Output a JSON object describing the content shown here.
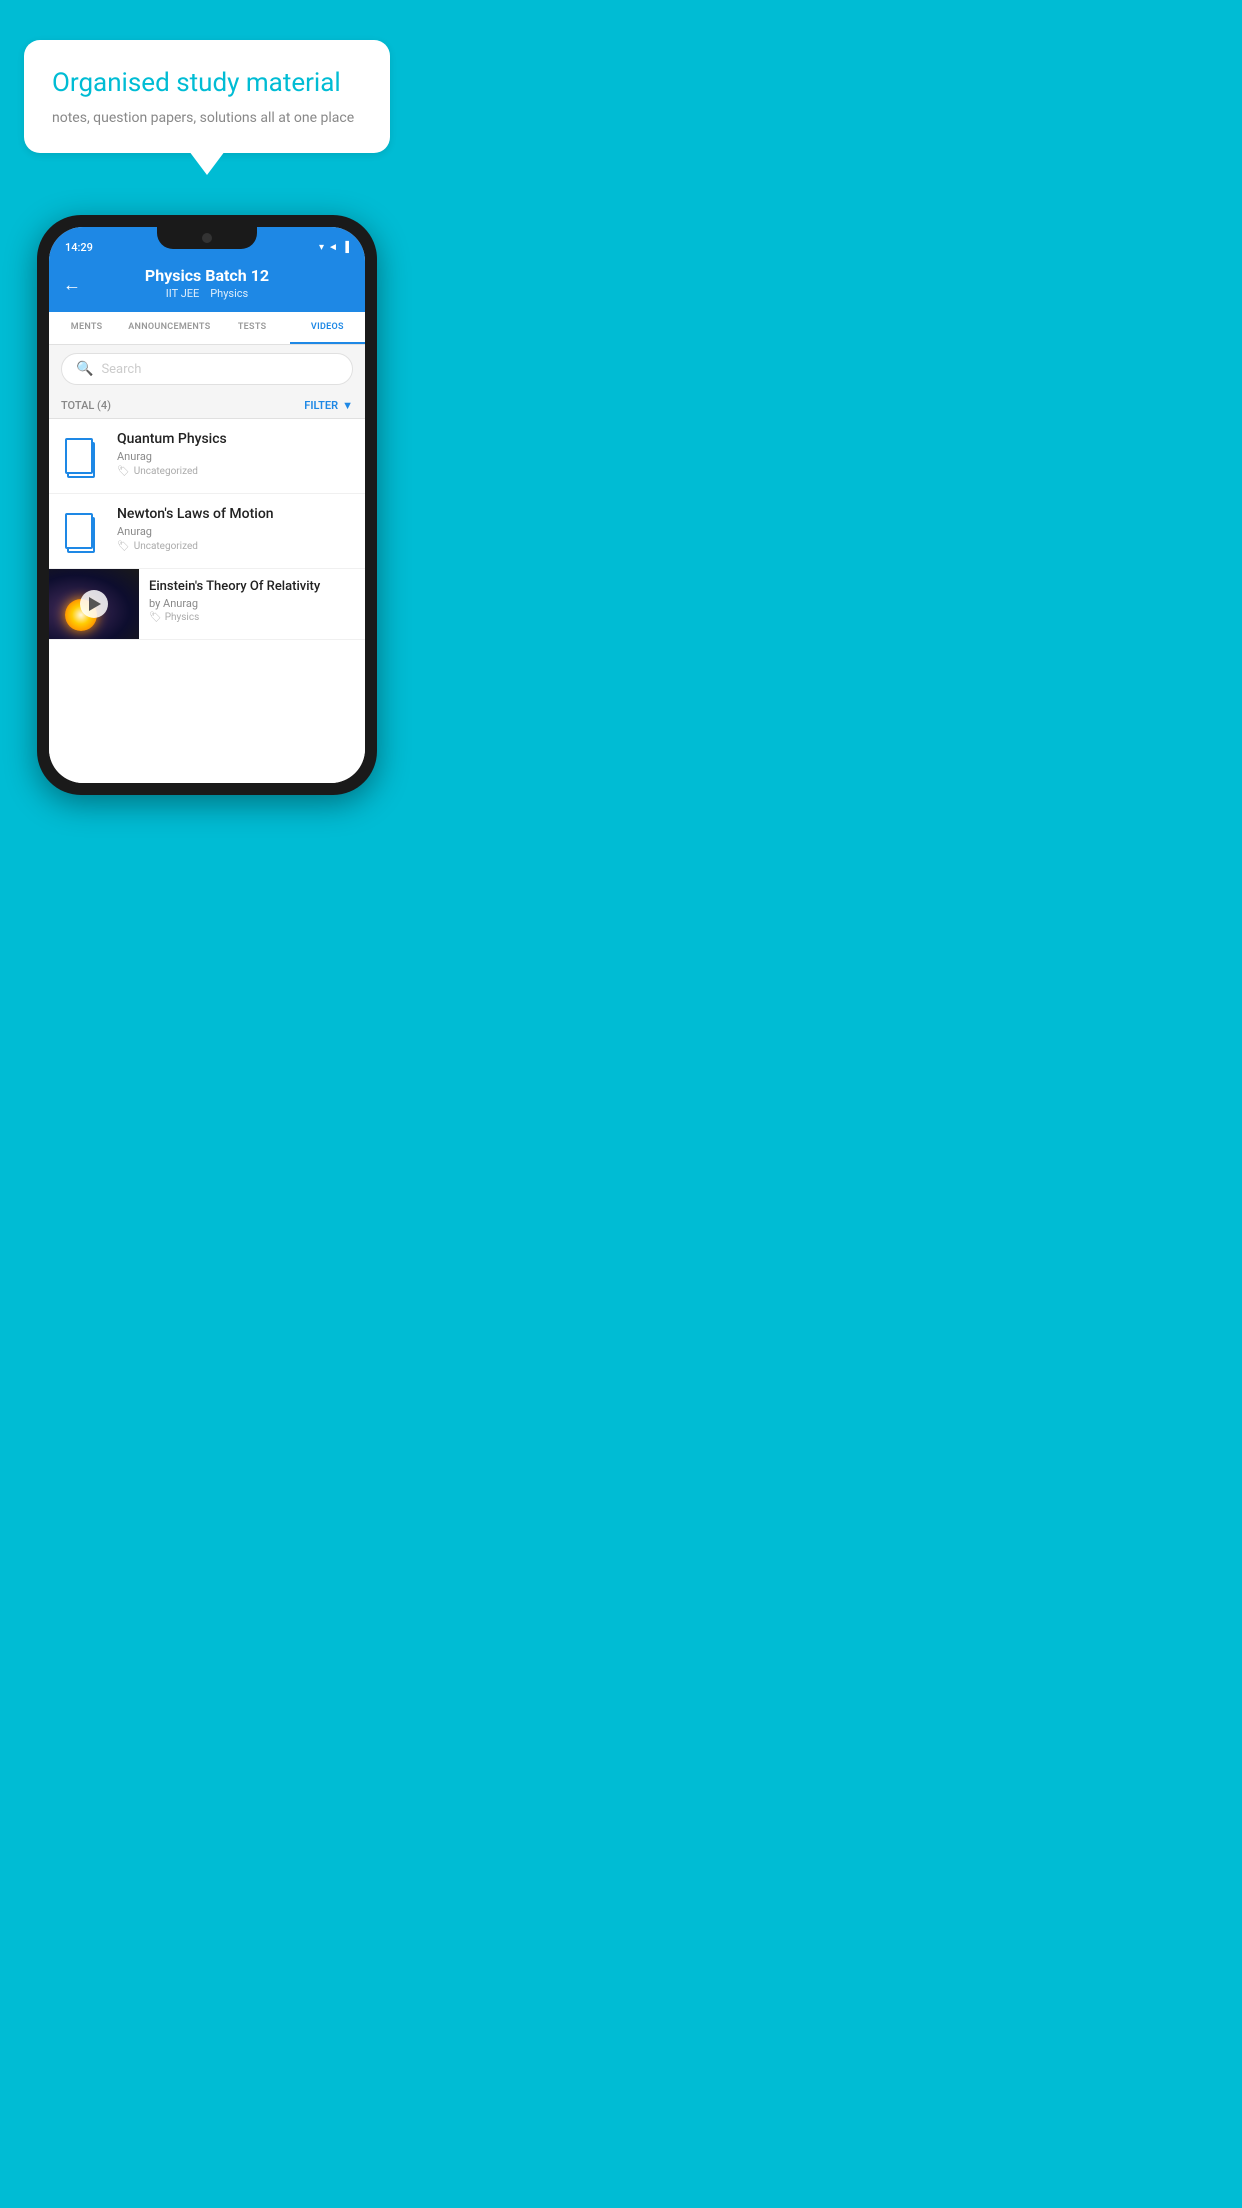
{
  "background_color": "#00bcd4",
  "speech_bubble": {
    "heading": "Organised study material",
    "subtext": "notes, question papers, solutions all at one place"
  },
  "phone": {
    "status_bar": {
      "time": "14:29",
      "icons": "▼◄▐"
    },
    "header": {
      "back_label": "←",
      "title": "Physics Batch 12",
      "subtitle_part1": "IIT JEE",
      "subtitle_part2": "Physics"
    },
    "tabs": [
      {
        "label": "MENTS",
        "active": false
      },
      {
        "label": "ANNOUNCEMENTS",
        "active": false
      },
      {
        "label": "TESTS",
        "active": false
      },
      {
        "label": "VIDEOS",
        "active": true
      }
    ],
    "search": {
      "placeholder": "Search"
    },
    "filter_bar": {
      "total_label": "TOTAL (4)",
      "filter_label": "FILTER"
    },
    "videos": [
      {
        "title": "Quantum Physics",
        "author": "Anurag",
        "tag": "Uncategorized",
        "has_thumbnail": false
      },
      {
        "title": "Newton's Laws of Motion",
        "author": "Anurag",
        "tag": "Uncategorized",
        "has_thumbnail": false
      },
      {
        "title": "Einstein's Theory Of Relativity",
        "author": "by Anurag",
        "tag": "Physics",
        "has_thumbnail": true
      }
    ]
  }
}
